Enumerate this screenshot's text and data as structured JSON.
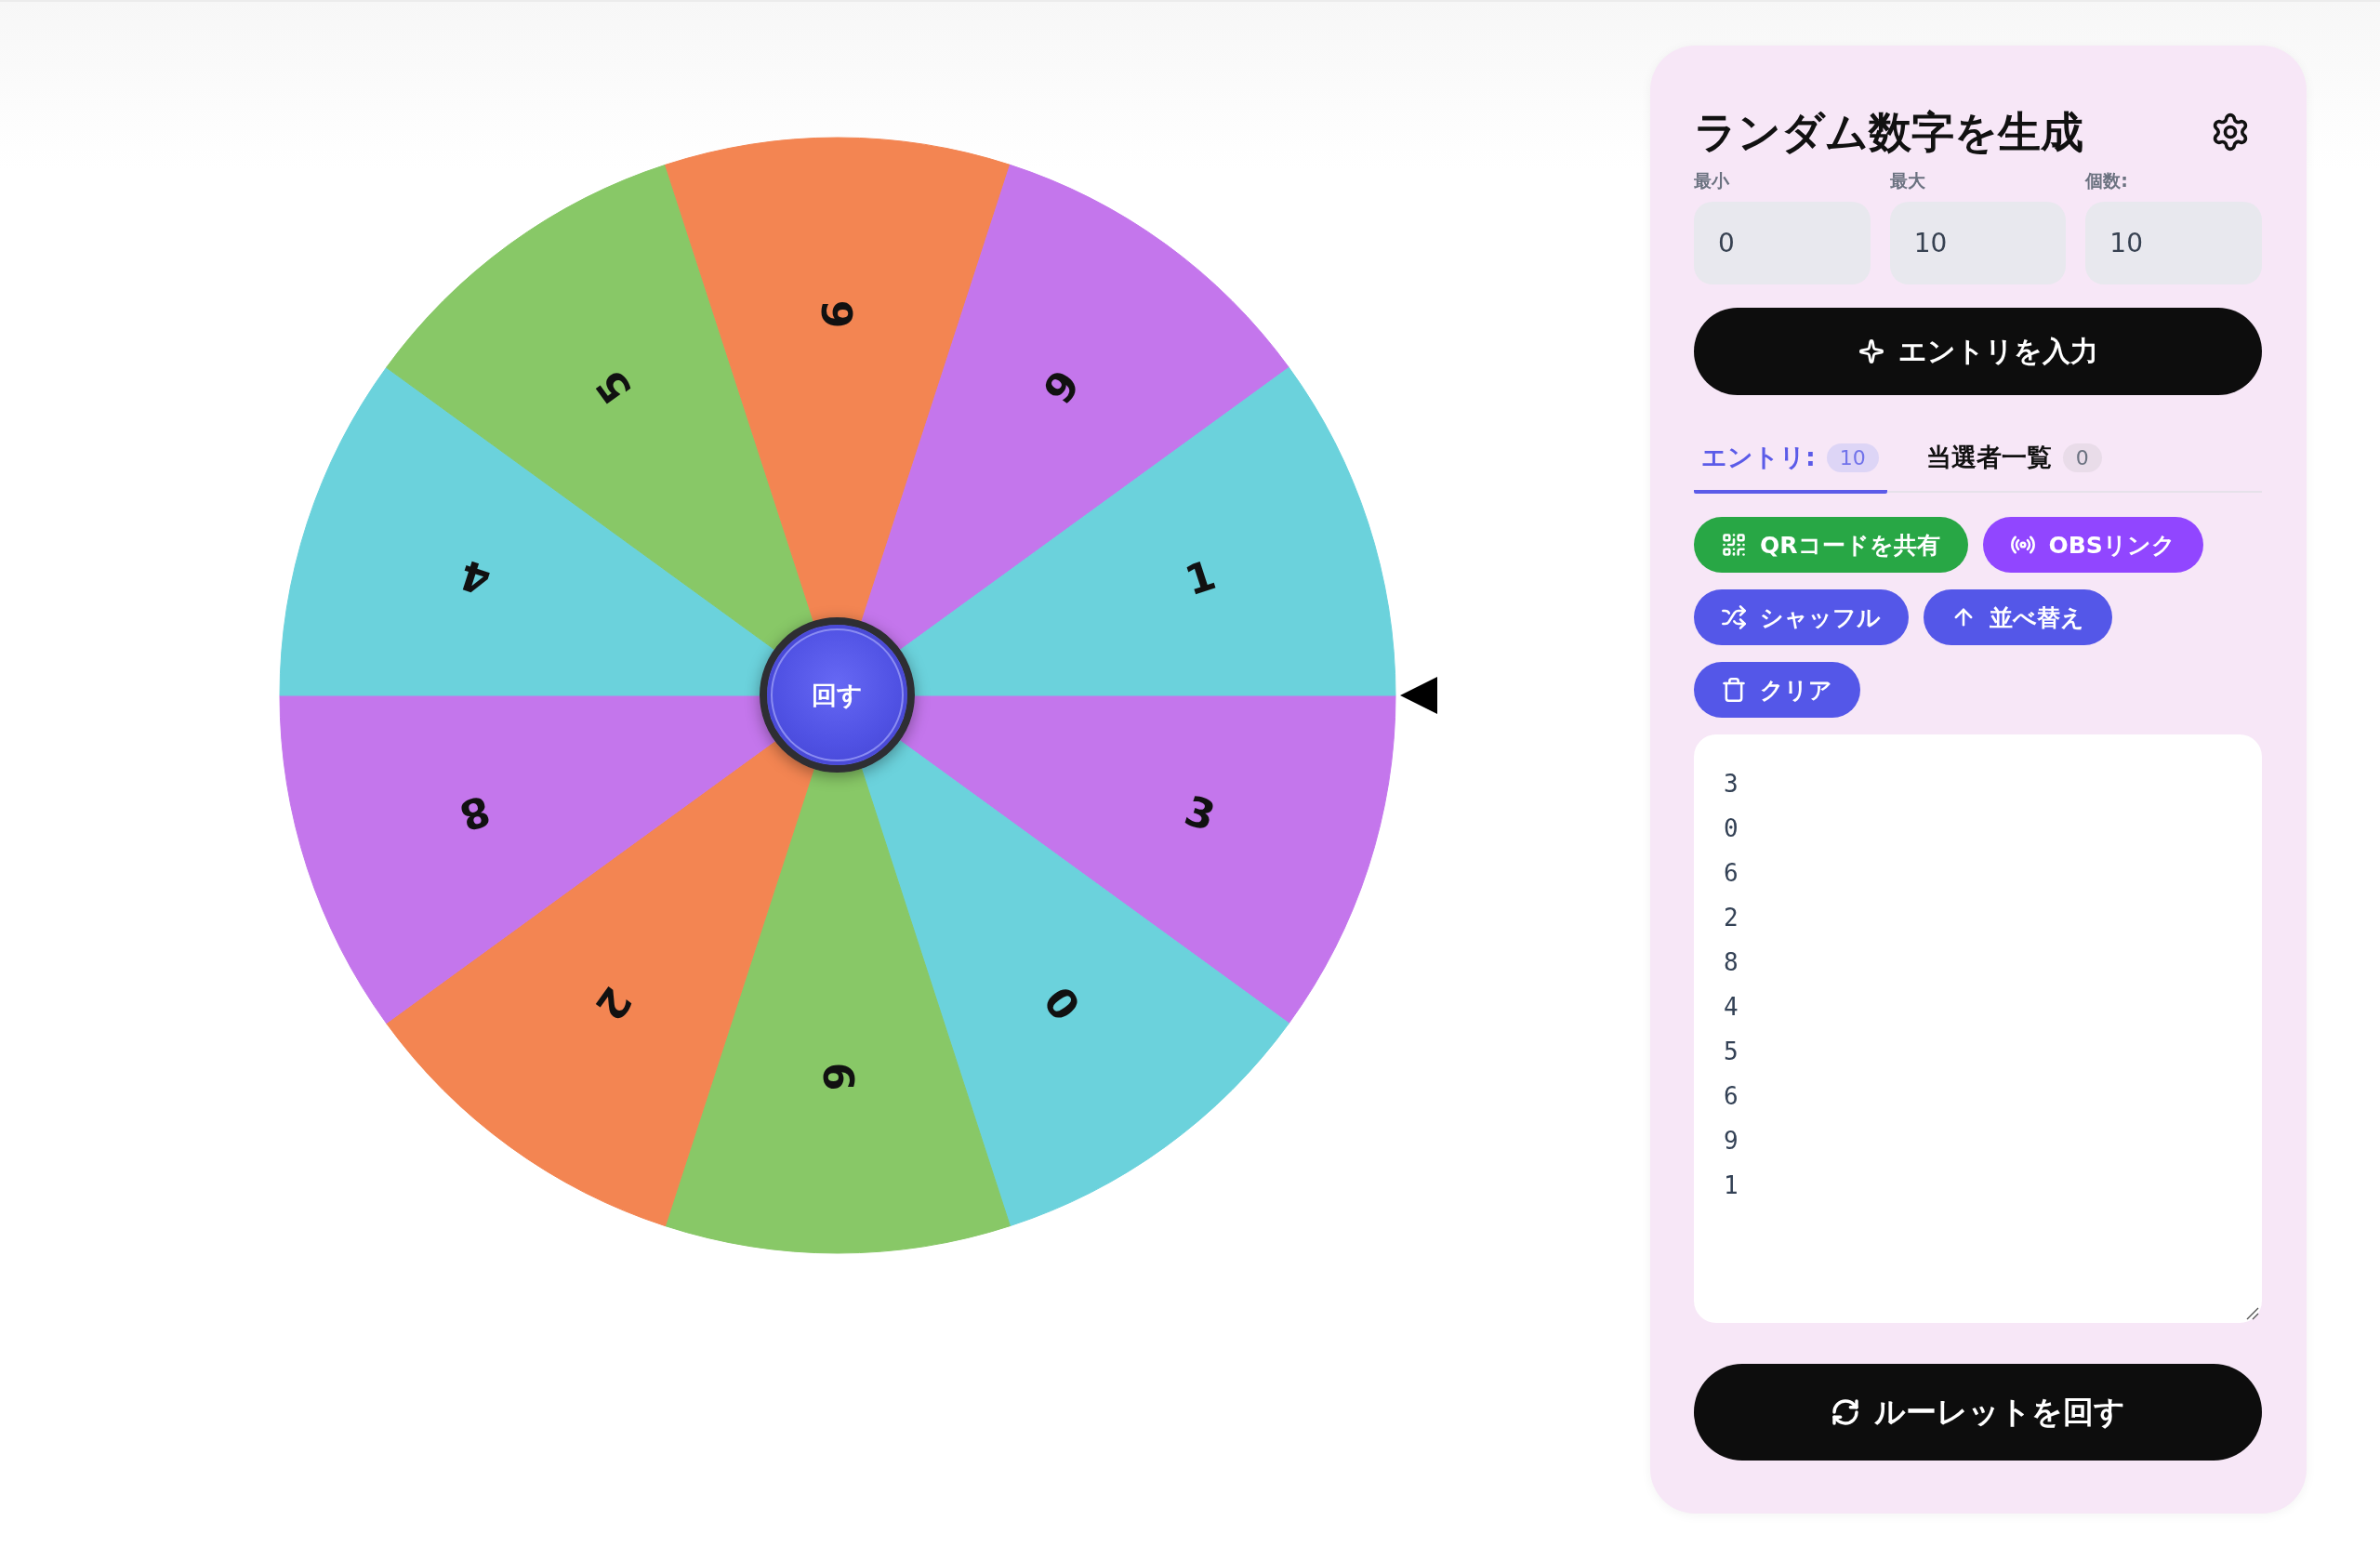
{
  "wheel": {
    "segments": [
      {
        "label": "3",
        "color": "#c476ec"
      },
      {
        "label": "0",
        "color": "#6bd2dc"
      },
      {
        "label": "6",
        "color": "#88c867"
      },
      {
        "label": "2",
        "color": "#f38552"
      },
      {
        "label": "8",
        "color": "#c476ec"
      },
      {
        "label": "4",
        "color": "#6bd2dc"
      },
      {
        "label": "5",
        "color": "#88c867"
      },
      {
        "label": "6",
        "color": "#f38552"
      },
      {
        "label": "9",
        "color": "#c476ec"
      },
      {
        "label": "1",
        "color": "#6bd2dc"
      }
    ],
    "spin_button": "回す"
  },
  "panel": {
    "title": "ランダム数字を生成",
    "fields": [
      {
        "label": "最小",
        "value": "0"
      },
      {
        "label": "最大",
        "value": "10"
      },
      {
        "label": "個数:",
        "value": "10"
      }
    ],
    "enter_button": "エントリを入力",
    "tabs": [
      {
        "label": "エントリ:",
        "count": "10",
        "selected": true
      },
      {
        "label": "当選者一覧",
        "count": "0",
        "selected": false
      }
    ],
    "actions": [
      {
        "label": "QRコードを共有",
        "kind": "qr",
        "color": "#28a745"
      },
      {
        "label": "OBSリンク",
        "kind": "obs",
        "color": "#9146ff"
      },
      {
        "label": "シャッフル",
        "kind": "shuffle",
        "color": "#5457e8"
      },
      {
        "label": "並べ替え",
        "kind": "sort",
        "color": "#5457e8"
      },
      {
        "label": "クリア",
        "kind": "clear",
        "color": "#5457e8"
      }
    ],
    "entries": [
      "3",
      "0",
      "6",
      "2",
      "8",
      "4",
      "5",
      "6",
      "9",
      "1"
    ],
    "spin_button": "ルーレットを回す"
  }
}
